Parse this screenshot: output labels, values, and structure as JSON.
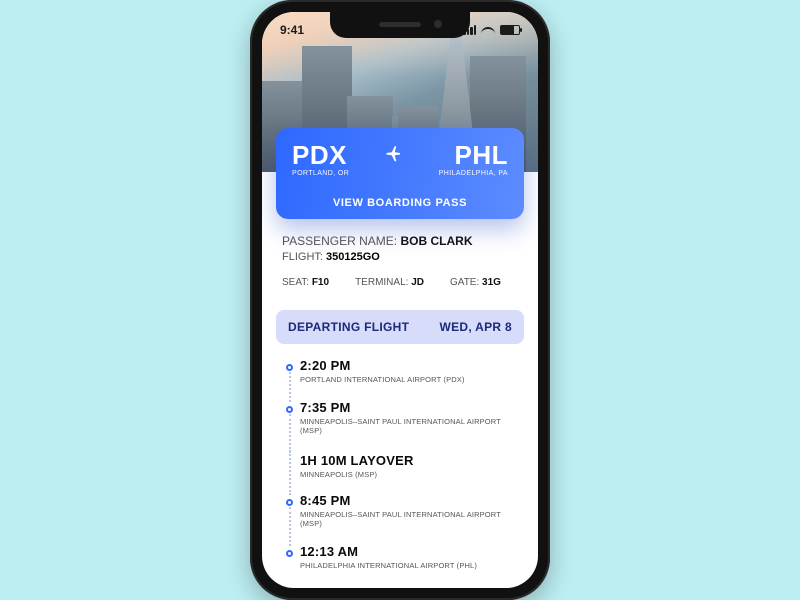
{
  "statusbar": {
    "time": "9:41"
  },
  "card": {
    "origin": {
      "code": "PDX",
      "city": "PORTLAND, OR"
    },
    "dest": {
      "code": "PHL",
      "city": "PHILADELPHIA, PA"
    },
    "view_label": "VIEW BOARDING PASS"
  },
  "passenger": {
    "name_label": "PASSENGER NAME: ",
    "name": "BOB CLARK",
    "flight_label": "FLIGHT: ",
    "flight": "350125GO",
    "seat_label": "SEAT: ",
    "seat": "F10",
    "terminal_label": "TERMINAL: ",
    "terminal": "JD",
    "gate_label": "GATE: ",
    "gate": "31G"
  },
  "departing": {
    "title": "DEPARTING FLIGHT",
    "date": "WED, APR 8"
  },
  "timeline": [
    {
      "kind": "stop",
      "time": "2:20 PM",
      "place": "PORTLAND INTERNATIONAL AIRPORT (PDX)"
    },
    {
      "kind": "stop",
      "time": "7:35 PM",
      "place": "MINNEAPOLIS–SAINT PAUL INTERNATIONAL AIRPORT (MSP)"
    },
    {
      "kind": "layover",
      "time": "1H 10M LAYOVER",
      "place": "MINNEAPOLIS (MSP)"
    },
    {
      "kind": "stop",
      "time": "8:45 PM",
      "place": "MINNEAPOLIS–SAINT PAUL INTERNATIONAL AIRPORT (MSP)"
    },
    {
      "kind": "stop",
      "time": "12:13 AM",
      "place": "PHILADELPHIA INTERNATIONAL AIRPORT (PHL)"
    }
  ]
}
